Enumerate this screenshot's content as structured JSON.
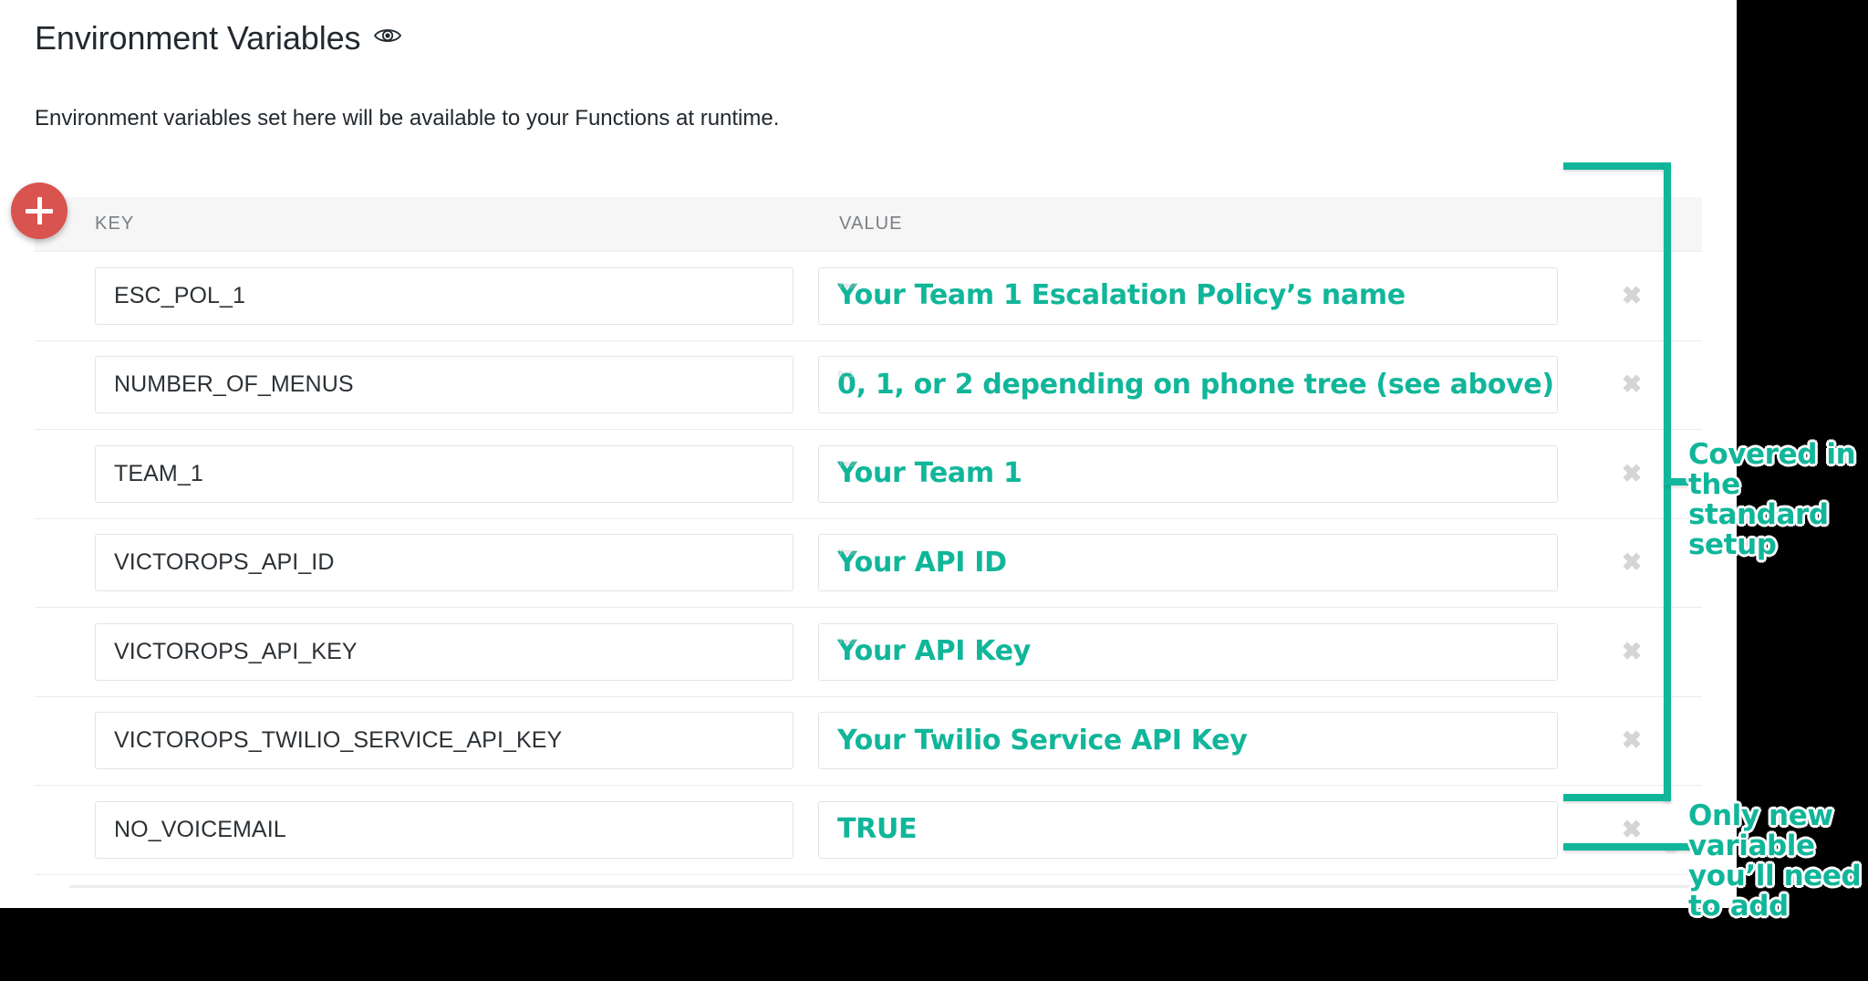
{
  "header": {
    "title": "Environment Variables",
    "visibility_icon": "eye-icon",
    "subtitle": "Environment variables set here will be available to your Functions at runtime."
  },
  "toolbar": {
    "add_label": "+",
    "add_icon": "plus-icon",
    "add_color": "#d9534f"
  },
  "table": {
    "columns": [
      "KEY",
      "VALUE"
    ],
    "delete_glyph": "✖",
    "rows": [
      {
        "key": "ESC_POL_1",
        "value": "Your Team 1 Escalation Policy’s name",
        "ghost": "Your"
      },
      {
        "key": "NUMBER_OF_MENUS",
        "value": "0, 1, or 2 depending on phone tree (see above)",
        "ghost": "0, 1"
      },
      {
        "key": "TEAM_1",
        "value": "Your Team 1",
        "ghost": "Your"
      },
      {
        "key": "VICTOROPS_API_ID",
        "value": "Your API ID",
        "ghost": "Your"
      },
      {
        "key": "VICTOROPS_API_KEY",
        "value": "Your API Key",
        "ghost": "Your"
      },
      {
        "key": "VICTOROPS_TWILIO_SERVICE_API_KEY",
        "value": "Your Twilio Service API Key",
        "ghost": ""
      },
      {
        "key": "NO_VOICEMAIL",
        "value": "TRUE",
        "ghost": ""
      }
    ]
  },
  "annotations": {
    "accent_color": "#11b69a",
    "covered": "Covered in the standard setup",
    "new_variable": "Only new variable you’ll need to add"
  }
}
